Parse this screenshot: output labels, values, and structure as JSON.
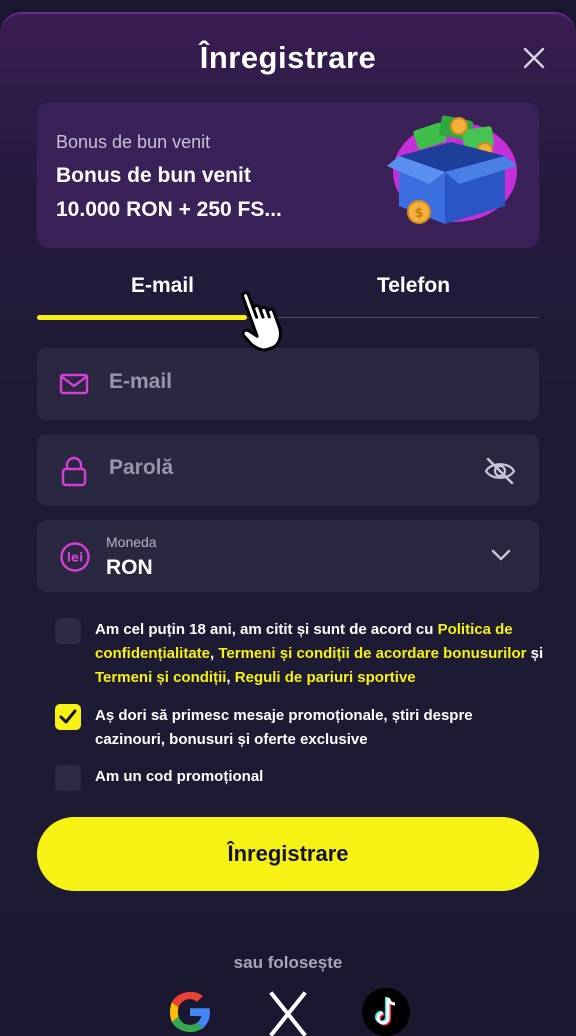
{
  "header": {
    "title": "Înregistrare"
  },
  "bonus": {
    "subtitle": "Bonus de bun venit",
    "title_line1": "Bonus de bun venit",
    "title_line2": "10.000 RON + 250 FS..."
  },
  "tabs": [
    {
      "label": "E-mail",
      "active": true
    },
    {
      "label": "Telefon",
      "active": false
    }
  ],
  "form": {
    "email_placeholder": "E-mail",
    "password_placeholder": "Parolă",
    "currency_label": "Moneda",
    "currency_value": "RON",
    "currency_icon_text": "lei"
  },
  "checkboxes": {
    "terms": {
      "checked": false,
      "prefix": "Am cel puțin 18 ani, am citit și sunt de acord cu ",
      "link1": "Politica de confidențialitate",
      "sep1": ", ",
      "link2": "Termeni și condiții de acordare bonusurilor",
      "sep2": " și ",
      "link3": "Termeni și condiții",
      "sep3": ", ",
      "link4": "Reguli de pariuri sportive"
    },
    "promo_messages": {
      "checked": true,
      "text": "Aș dori să primesc mesaje promoționale, știri despre cazinouri, bonusuri și oferte exclusive"
    },
    "promo_code": {
      "checked": false,
      "text": "Am un cod promoțional"
    }
  },
  "submit_label": "Înregistrare",
  "footer": {
    "or_use": "sau folosește"
  },
  "colors": {
    "accent": "#f6f314",
    "icon_magenta": "#d63fd6",
    "background": "#1a1730"
  },
  "icons": [
    "close-icon",
    "envelope-icon",
    "lock-icon",
    "eye-off-icon",
    "lei-icon",
    "chevron-down-icon",
    "check-icon",
    "google-icon",
    "x-icon",
    "tiktok-icon",
    "hand-cursor-icon"
  ]
}
